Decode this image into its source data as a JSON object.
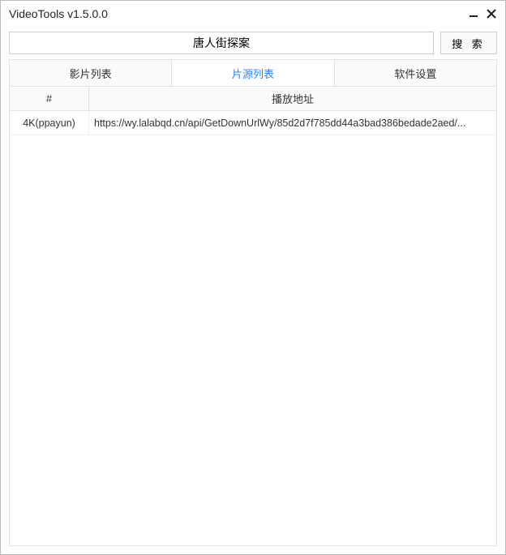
{
  "window": {
    "title": "VideoTools v1.5.0.0"
  },
  "search": {
    "value": "唐人街探案",
    "button_label": "搜 索"
  },
  "tabs": {
    "items": [
      {
        "label": "影片列表"
      },
      {
        "label": "片源列表"
      },
      {
        "label": "软件设置"
      }
    ],
    "active_index": 1
  },
  "columns": {
    "num": "#",
    "url": "播放地址"
  },
  "rows": [
    {
      "quality": "4K(ppayun)",
      "url": "https://wy.lalabqd.cn/api/GetDownUrlWy/85d2d7f785dd44a3bad386bedade2aed/..."
    }
  ]
}
